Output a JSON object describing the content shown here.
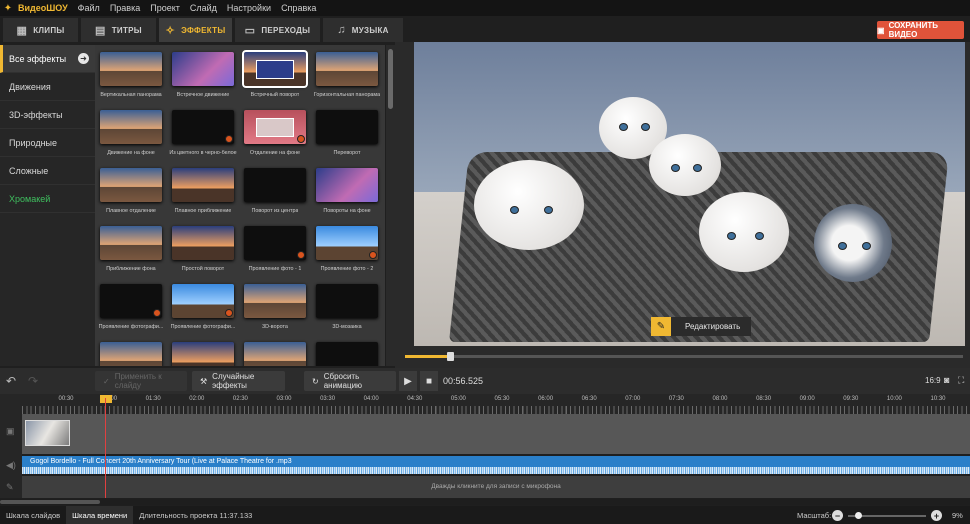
{
  "app": {
    "name": "ВидеоШОУ"
  },
  "menu": [
    "Файл",
    "Правка",
    "Проект",
    "Слайд",
    "Настройки",
    "Справка"
  ],
  "tabs": [
    {
      "label": "КЛИПЫ",
      "icon": "clips-icon"
    },
    {
      "label": "ТИТРЫ",
      "icon": "titles-icon"
    },
    {
      "label": "ЭФФЕКТЫ",
      "icon": "effects-icon",
      "active": true
    },
    {
      "label": "ПЕРЕХОДЫ",
      "icon": "transitions-icon"
    },
    {
      "label": "МУЗЫКА",
      "icon": "music-icon"
    }
  ],
  "save_button": "СОХРАНИТЬ ВИДЕО",
  "categories": [
    {
      "label": "Все эффекты",
      "active": true
    },
    {
      "label": "Движения"
    },
    {
      "label": "3D-эффекты"
    },
    {
      "label": "Природные"
    },
    {
      "label": "Сложные"
    },
    {
      "label": "Хромакей",
      "color": "#3fbf5f"
    }
  ],
  "effects": [
    "Вертикальная панорама",
    "Встречное движение",
    "Встречный поворот",
    "Горизонтальная панорама",
    "Движение на фоне",
    "Из цветного в черно-белое",
    "Отдаление на фоне",
    "Переворот",
    "Плавное отдаление",
    "Плавное приближение",
    "Поворот из центра",
    "Повороты на фоне",
    "Приближение фона",
    "Простой поворот",
    "Проявление фото - 1",
    "Проявление фото - 2",
    "Проявление фотографи...",
    "Проявление фотографи...",
    "3D-ворота",
    "3D-мозаика",
    "",
    "",
    "",
    ""
  ],
  "preview": {
    "edit_button": "Редактировать",
    "seek_progress": 0.08
  },
  "toolbar": {
    "apply": "Применить к слайду",
    "random": "Случайные эффекты",
    "reset": "Сбросить анимацию",
    "timecode": "00:56.525",
    "ratio": "16:9"
  },
  "ruler": [
    "00:30",
    "01:00",
    "01:30",
    "02:00",
    "02:30",
    "03:00",
    "03:30",
    "04:00",
    "04:30",
    "05:00",
    "05:30",
    "06:00",
    "06:30",
    "07:00",
    "07:30",
    "08:00",
    "08:30",
    "09:00",
    "09:30",
    "10:00",
    "10:30"
  ],
  "audio_track": "Gogol Bordello - Full Concert 20th Anniversary Tour (Live at Palace Theatre for .mp3",
  "mic_track": "Дважды кликните для записи с микрофона",
  "status": {
    "slides_tab": "Шкала слайдов",
    "timeline_tab": "Шкала времени",
    "duration": "Длительность проекта 11:37.133",
    "zoom_label": "Масштаб:",
    "zoom_value": "9%"
  },
  "colors": {
    "accent": "#f0b832",
    "save": "#e0533a",
    "audio": "#2a7fc9"
  }
}
